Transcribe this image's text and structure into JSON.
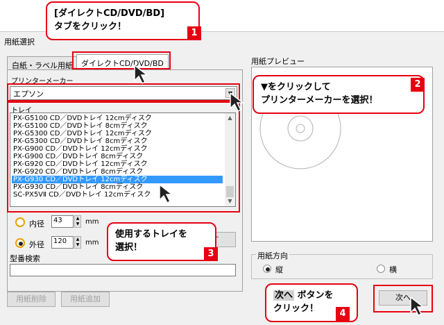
{
  "dialog": {
    "title": "用紙選択",
    "tabs": [
      {
        "label": "白紙・ラベル用紙",
        "active": false
      },
      {
        "label": "ダイレクトCD/DVD/BD",
        "active": true
      }
    ],
    "printer_maker_label": "プリンターメーカー",
    "printer_maker_value": "エプソン",
    "tray_label": "トレイ",
    "tray_items": [
      "PX-G5100 CD／DVDトレイ 12cmディスク",
      "PX-G5100 CD／DVDトレイ 8cmディスク",
      "PX-G5300 CD／DVDトレイ 12cmディスク",
      "PX-G5300 CD／DVDトレイ 8cmディスク",
      "PX-G900 CD／DVDトレイ 12cmディスク",
      "PX-G900 CD／DVDトレイ 8cmディスク",
      "PX-G920 CD／DVDトレイ 12cmディスク",
      "PX-G920 CD／DVDトレイ 8cmディスク",
      "PX-G930 CD／DVDトレイ 12cmディスク",
      "PX-G930 CD／DVDトレイ 8cmディスク",
      "SC-PX5VⅡ CD／DVDトレイ 12cmディスク"
    ],
    "selected_tray_index": 8,
    "inner_diameter": {
      "label": "内径",
      "value": "43",
      "unit": "mm"
    },
    "outer_diameter": {
      "label": "外径",
      "value": "120",
      "unit": "mm"
    },
    "partial_button_label": "す",
    "model_search_label": "型番検索",
    "model_search_value": "",
    "delete_button": "用紙削除",
    "add_button": "用紙追加",
    "preview_label": "用紙プレビュー",
    "orientation_label": "用紙方向",
    "orientation_portrait": "縦",
    "orientation_landscape": "横",
    "orientation_selected": "portrait",
    "next_button": "次へ"
  },
  "callouts": {
    "c1": {
      "line1": "[ダイレクトCD/DVD/BD]",
      "line2": "タブをクリック！",
      "num": "1"
    },
    "c2": {
      "line1": "▼をクリックして",
      "line2": "プリンターメーカーを選択！",
      "num": "2"
    },
    "c3": {
      "line1": "使用するトレイを",
      "line2": "選択！",
      "num": "3"
    },
    "c4": {
      "line1_key": "次へ",
      "line1_rest": "ボタンを",
      "line2": "クリック！",
      "num": "4"
    }
  },
  "colors": {
    "accent": "#e60012",
    "selection": "#3399ff",
    "dialog_bg": "#f0f0f0"
  }
}
